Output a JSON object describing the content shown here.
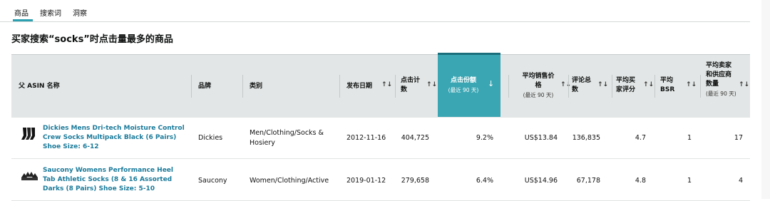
{
  "tabs": [
    {
      "label": "商品",
      "active": true
    },
    {
      "label": "搜索词",
      "active": false
    },
    {
      "label": "洞察",
      "active": false
    }
  ],
  "title": "买家搜索“socks”时点击量最多的商品",
  "columns": {
    "name": "父 ASIN 名称",
    "brand": "品牌",
    "category": "类别",
    "release_date": "发布日期",
    "clicks_line1": "点击计",
    "clicks_line2": "数",
    "click_share": "点击份额",
    "click_share_sub": "(最近 90 天)",
    "avg_price_line1": "平均销售价",
    "avg_price_line2": "格",
    "avg_price_sub": "(最近 90 天)",
    "reviews_line1": "评论总",
    "reviews_line2": "数",
    "rating_line1": "平均买",
    "rating_line2": "家评分",
    "bsr_line1": "平均",
    "bsr_line2": "BSR",
    "sellers_line1": "平均卖家",
    "sellers_line2": "和供应商",
    "sellers_line3": "数量",
    "sellers_sub": "(最近 90 天)",
    "sort_icon": "↑↓",
    "active_sort_icon": "↓"
  },
  "rows": [
    {
      "name": "Dickies Mens Dri-tech Moisture Control Crew Socks Multipack Black (6 Pairs) Shoe Size: 6-12",
      "brand": "Dickies",
      "category": "Men/Clothing/Socks & Hosiery",
      "release_date": "2012-11-16",
      "clicks": "404,725",
      "click_share": "9.2%",
      "avg_price": "US$13.84",
      "reviews": "136,835",
      "rating": "4.7",
      "bsr": "1",
      "sellers": "17",
      "thumb_icon": "black-socks-image"
    },
    {
      "name": "Saucony Womens Performance Heel Tab Athletic Socks (8 & 16 Assorted Darks (8 Pairs) Shoe Size: 5-10",
      "brand": "Saucony",
      "category": "Women/Clothing/Active",
      "release_date": "2019-01-12",
      "clicks": "279,658",
      "click_share": "6.4%",
      "avg_price": "US$14.96",
      "reviews": "67,178",
      "rating": "4.8",
      "bsr": "1",
      "sellers": "4",
      "thumb_icon": "socks-fan-image"
    }
  ]
}
